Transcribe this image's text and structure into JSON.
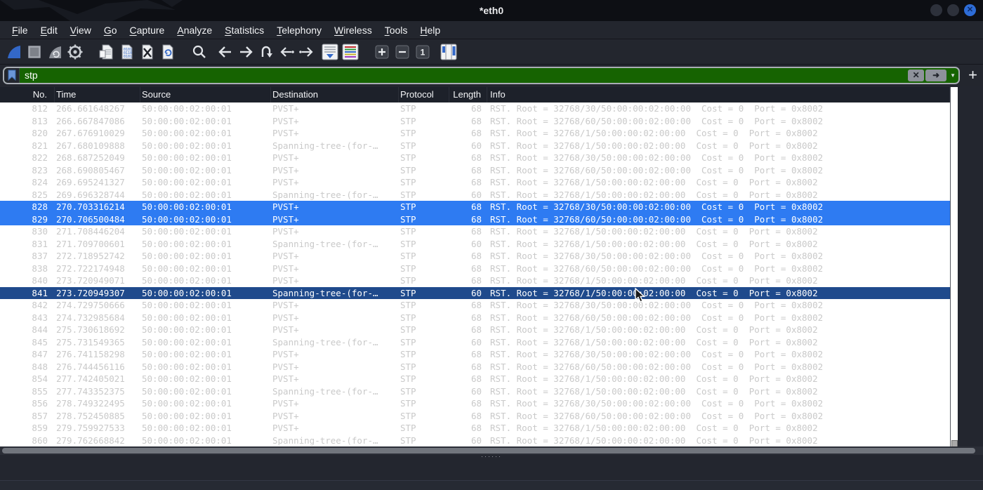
{
  "window": {
    "title": "*eth0",
    "controls": {
      "minimize": "",
      "maximize": "",
      "close": "✕"
    }
  },
  "menu_bar": {
    "items": [
      {
        "label": "File"
      },
      {
        "label": "Edit"
      },
      {
        "label": "View"
      },
      {
        "label": "Go"
      },
      {
        "label": "Capture"
      },
      {
        "label": "Analyze"
      },
      {
        "label": "Statistics"
      },
      {
        "label": "Telephony"
      },
      {
        "label": "Wireless"
      },
      {
        "label": "Tools"
      },
      {
        "label": "Help"
      }
    ]
  },
  "toolbar": {
    "icons": [
      "start-capture",
      "stop-capture",
      "restart-capture",
      "capture-options",
      "open-file",
      "save-file",
      "close-file",
      "reload-file",
      "find-packet",
      "go-back",
      "go-forward",
      "go-to-packet",
      "go-first-packet",
      "go-last-packet",
      "auto-scroll",
      "colorize-packets",
      "zoom-in",
      "zoom-out",
      "normal-size",
      "resize-columns"
    ]
  },
  "filter_bar": {
    "value": "stp",
    "clear_label": "✕",
    "apply_label": "➜",
    "dropdown_label": "▼",
    "add_button_label": "+"
  },
  "packet_list": {
    "columns": [
      "No.",
      "Time",
      "Source",
      "Destination",
      "Protocol",
      "Length",
      "Info"
    ],
    "rows": [
      {
        "no": "812",
        "time": "266.661648267",
        "source": "50:00:00:02:00:01",
        "destination": "PVST+",
        "protocol": "STP",
        "length": "68",
        "info": "RST. Root = 32768/30/50:00:00:02:00:00  Cost = 0  Port = 0x8002",
        "state": "normal"
      },
      {
        "no": "813",
        "time": "266.667847086",
        "source": "50:00:00:02:00:01",
        "destination": "PVST+",
        "protocol": "STP",
        "length": "68",
        "info": "RST. Root = 32768/60/50:00:00:02:00:00  Cost = 0  Port = 0x8002",
        "state": "normal"
      },
      {
        "no": "820",
        "time": "267.676910029",
        "source": "50:00:00:02:00:01",
        "destination": "PVST+",
        "protocol": "STP",
        "length": "68",
        "info": "RST. Root = 32768/1/50:00:00:02:00:00  Cost = 0  Port = 0x8002",
        "state": "normal"
      },
      {
        "no": "821",
        "time": "267.680109888",
        "source": "50:00:00:02:00:01",
        "destination": "Spanning-tree-(for-…",
        "protocol": "STP",
        "length": "60",
        "info": "RST. Root = 32768/1/50:00:00:02:00:00  Cost = 0  Port = 0x8002",
        "state": "normal"
      },
      {
        "no": "822",
        "time": "268.687252049",
        "source": "50:00:00:02:00:01",
        "destination": "PVST+",
        "protocol": "STP",
        "length": "68",
        "info": "RST. Root = 32768/30/50:00:00:02:00:00  Cost = 0  Port = 0x8002",
        "state": "normal"
      },
      {
        "no": "823",
        "time": "268.690805467",
        "source": "50:00:00:02:00:01",
        "destination": "PVST+",
        "protocol": "STP",
        "length": "68",
        "info": "RST. Root = 32768/60/50:00:00:02:00:00  Cost = 0  Port = 0x8002",
        "state": "normal"
      },
      {
        "no": "824",
        "time": "269.695241327",
        "source": "50:00:00:02:00:01",
        "destination": "PVST+",
        "protocol": "STP",
        "length": "68",
        "info": "RST. Root = 32768/1/50:00:00:02:00:00  Cost = 0  Port = 0x8002",
        "state": "normal"
      },
      {
        "no": "825",
        "time": "269.696328744",
        "source": "50:00:00:02:00:01",
        "destination": "Spanning-tree-(for-…",
        "protocol": "STP",
        "length": "60",
        "info": "RST. Root = 32768/1/50:00:00:02:00:00  Cost = 0  Port = 0x8002",
        "state": "normal"
      },
      {
        "no": "828",
        "time": "270.703316214",
        "source": "50:00:00:02:00:01",
        "destination": "PVST+",
        "protocol": "STP",
        "length": "68",
        "info": "RST. Root = 32768/30/50:00:00:02:00:00  Cost = 0  Port = 0x8002",
        "state": "selected"
      },
      {
        "no": "829",
        "time": "270.706500484",
        "source": "50:00:00:02:00:01",
        "destination": "PVST+",
        "protocol": "STP",
        "length": "68",
        "info": "RST. Root = 32768/60/50:00:00:02:00:00  Cost = 0  Port = 0x8002",
        "state": "selected"
      },
      {
        "no": "830",
        "time": "271.708446204",
        "source": "50:00:00:02:00:01",
        "destination": "PVST+",
        "protocol": "STP",
        "length": "68",
        "info": "RST. Root = 32768/1/50:00:00:02:00:00  Cost = 0  Port = 0x8002",
        "state": "normal"
      },
      {
        "no": "831",
        "time": "271.709700601",
        "source": "50:00:00:02:00:01",
        "destination": "Spanning-tree-(for-…",
        "protocol": "STP",
        "length": "60",
        "info": "RST. Root = 32768/1/50:00:00:02:00:00  Cost = 0  Port = 0x8002",
        "state": "normal"
      },
      {
        "no": "837",
        "time": "272.718952742",
        "source": "50:00:00:02:00:01",
        "destination": "PVST+",
        "protocol": "STP",
        "length": "68",
        "info": "RST. Root = 32768/30/50:00:00:02:00:00  Cost = 0  Port = 0x8002",
        "state": "normal"
      },
      {
        "no": "838",
        "time": "272.722174948",
        "source": "50:00:00:02:00:01",
        "destination": "PVST+",
        "protocol": "STP",
        "length": "68",
        "info": "RST. Root = 32768/60/50:00:00:02:00:00  Cost = 0  Port = 0x8002",
        "state": "normal"
      },
      {
        "no": "840",
        "time": "273.720949071",
        "source": "50:00:00:02:00:01",
        "destination": "PVST+",
        "protocol": "STP",
        "length": "68",
        "info": "RST. Root = 32768/1/50:00:00:02:00:00  Cost = 0  Port = 0x8002",
        "state": "normal"
      },
      {
        "no": "841",
        "time": "273.720949307",
        "source": "50:00:00:02:00:01",
        "destination": "Spanning-tree-(for-…",
        "protocol": "STP",
        "length": "60",
        "info": "RST. Root = 32768/1/50:00:00:02:00:00  Cost = 0  Port = 0x8002",
        "state": "focused"
      },
      {
        "no": "842",
        "time": "274.729750666",
        "source": "50:00:00:02:00:01",
        "destination": "PVST+",
        "protocol": "STP",
        "length": "68",
        "info": "RST. Root = 32768/30/50:00:00:02:00:00  Cost = 0  Port = 0x8002",
        "state": "normal"
      },
      {
        "no": "843",
        "time": "274.732985684",
        "source": "50:00:00:02:00:01",
        "destination": "PVST+",
        "protocol": "STP",
        "length": "68",
        "info": "RST. Root = 32768/60/50:00:00:02:00:00  Cost = 0  Port = 0x8002",
        "state": "normal"
      },
      {
        "no": "844",
        "time": "275.730618692",
        "source": "50:00:00:02:00:01",
        "destination": "PVST+",
        "protocol": "STP",
        "length": "68",
        "info": "RST. Root = 32768/1/50:00:00:02:00:00  Cost = 0  Port = 0x8002",
        "state": "normal"
      },
      {
        "no": "845",
        "time": "275.731549365",
        "source": "50:00:00:02:00:01",
        "destination": "Spanning-tree-(for-…",
        "protocol": "STP",
        "length": "60",
        "info": "RST. Root = 32768/1/50:00:00:02:00:00  Cost = 0  Port = 0x8002",
        "state": "normal"
      },
      {
        "no": "847",
        "time": "276.741158298",
        "source": "50:00:00:02:00:01",
        "destination": "PVST+",
        "protocol": "STP",
        "length": "68",
        "info": "RST. Root = 32768/30/50:00:00:02:00:00  Cost = 0  Port = 0x8002",
        "state": "normal"
      },
      {
        "no": "848",
        "time": "276.744456116",
        "source": "50:00:00:02:00:01",
        "destination": "PVST+",
        "protocol": "STP",
        "length": "68",
        "info": "RST. Root = 32768/60/50:00:00:02:00:00  Cost = 0  Port = 0x8002",
        "state": "normal"
      },
      {
        "no": "854",
        "time": "277.742405021",
        "source": "50:00:00:02:00:01",
        "destination": "PVST+",
        "protocol": "STP",
        "length": "68",
        "info": "RST. Root = 32768/1/50:00:00:02:00:00  Cost = 0  Port = 0x8002",
        "state": "normal"
      },
      {
        "no": "855",
        "time": "277.743352375",
        "source": "50:00:00:02:00:01",
        "destination": "Spanning-tree-(for-…",
        "protocol": "STP",
        "length": "60",
        "info": "RST. Root = 32768/1/50:00:00:02:00:00  Cost = 0  Port = 0x8002",
        "state": "normal"
      },
      {
        "no": "856",
        "time": "278.749322495",
        "source": "50:00:00:02:00:01",
        "destination": "PVST+",
        "protocol": "STP",
        "length": "68",
        "info": "RST. Root = 32768/30/50:00:00:02:00:00  Cost = 0  Port = 0x8002",
        "state": "normal"
      },
      {
        "no": "857",
        "time": "278.752450885",
        "source": "50:00:00:02:00:01",
        "destination": "PVST+",
        "protocol": "STP",
        "length": "68",
        "info": "RST. Root = 32768/60/50:00:00:02:00:00  Cost = 0  Port = 0x8002",
        "state": "normal"
      },
      {
        "no": "859",
        "time": "279.759927533",
        "source": "50:00:00:02:00:01",
        "destination": "PVST+",
        "protocol": "STP",
        "length": "68",
        "info": "RST. Root = 32768/1/50:00:00:02:00:00  Cost = 0  Port = 0x8002",
        "state": "normal"
      },
      {
        "no": "860",
        "time": "279.762668842",
        "source": "50:00:00:02:00:01",
        "destination": "Spanning-tree-(for-…",
        "protocol": "STP",
        "length": "60",
        "info": "RST. Root = 32768/1/50:00:00:02:00:00  Cost = 0  Port = 0x8002",
        "state": "normal"
      }
    ]
  },
  "splitter": {
    "handle": "······"
  },
  "colors": {
    "filter_match_bg": "#166301",
    "row_selected_bg": "#2e7bf2",
    "row_focused_bg": "#1f4a8c",
    "row_text": "#c9c9c9",
    "titlebar_bg": "#0d0f14",
    "chrome_bg": "#23262e",
    "header_bg": "#1d212a",
    "close_button_bg": "#2d6cd6"
  }
}
